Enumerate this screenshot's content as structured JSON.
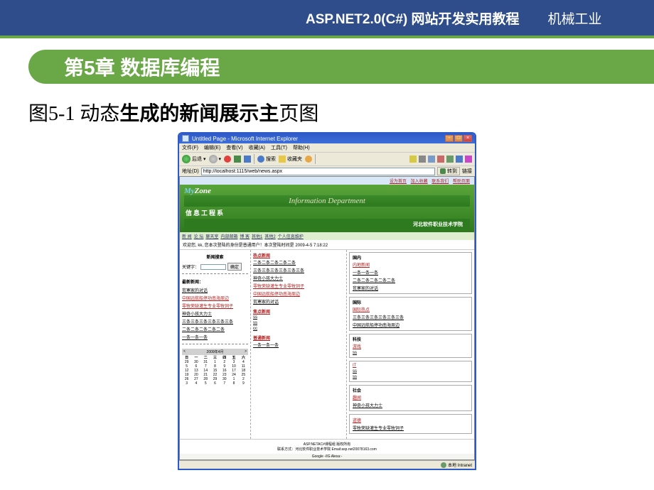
{
  "top": {
    "title": "ASP.NET2.0(C#) 网站开发实用教程",
    "publisher": "机械工业"
  },
  "chapter": "第5章 数据库编程",
  "figure_caption": {
    "prefix": "图5-1 动态",
    "bold1": "生成的新闻",
    "mid": "展示主",
    "suffix": "页图"
  },
  "ie": {
    "title": "Untitled Page - Microsoft Internet Explorer",
    "menus": [
      "文件(F)",
      "编辑(E)",
      "查看(V)",
      "收藏(A)",
      "工具(T)",
      "帮助(H)"
    ],
    "back": "后退",
    "search": "搜索",
    "fav": "收藏夹",
    "addr_label": "地址(D)",
    "url": "http://localhost:1115/web/news.aspx",
    "go": "转到",
    "links": "链接",
    "status_left": "",
    "status_right": "本地 Intranet"
  },
  "site": {
    "logo_my": "My",
    "logo_zone": "Zone",
    "toplinks": [
      "设为首页",
      "加入收藏",
      "联系我们",
      "帮助页面"
    ],
    "dept_en": "Information Department",
    "dept_cn": "信息工程系",
    "school": "河北软件职业技术学院",
    "nav": [
      "新 闻",
      "论 坛",
      "聊天室",
      "内部邮箱",
      "博 客",
      "其他1",
      "其他2",
      "个人信息维护"
    ],
    "welcome": "欢迎您, kk, 您本次登陆的身份是普通用户！本次登陆时间是 2009-4-5 7:18:22"
  },
  "left": {
    "search_title": "新闻搜索",
    "keyword_label": "关键字：",
    "btn_ok": "确定",
    "latest_title": "最新新闻：",
    "latest": [
      {
        "t": "贫寒家的对话",
        "red": false
      },
      {
        "t": "中国远航船停功南海周边",
        "red": true
      },
      {
        "t": "零牧荣缺灌生专业零牧饲子",
        "red": true
      },
      {
        "t": "神奇小孩大力士",
        "red": false
      },
      {
        "t": "三条三条三条三条三条三条",
        "red": false
      },
      {
        "t": "二条二条二条二条二条",
        "red": false
      },
      {
        "t": "一条一条一条",
        "red": false
      }
    ],
    "cal_month": "2009年4月",
    "cal_days": [
      "日",
      "一",
      "二",
      "三",
      "四",
      "五",
      "六"
    ],
    "cal_rows": [
      [
        "29",
        "30",
        "31",
        "1",
        "2",
        "3",
        "4"
      ],
      [
        "5",
        "6",
        "7",
        "8",
        "9",
        "10",
        "11"
      ],
      [
        "12",
        "13",
        "14",
        "15",
        "16",
        "17",
        "18"
      ],
      [
        "19",
        "20",
        "21",
        "22",
        "23",
        "24",
        "25"
      ],
      [
        "26",
        "27",
        "28",
        "29",
        "30",
        "1",
        "2"
      ],
      [
        "3",
        "4",
        "5",
        "6",
        "7",
        "8",
        "9"
      ]
    ]
  },
  "mid": {
    "hot_title": "热点新闻",
    "hot": [
      {
        "t": "二条二条二条二条二条",
        "red": false
      },
      {
        "t": "三条三条三条三条三条三条",
        "red": false
      },
      {
        "t": "神奇小孩大力士",
        "red": false
      },
      {
        "t": "零牧荣缺灌生专业零牧饲子",
        "red": true
      },
      {
        "t": "中国远航船停功南海周边",
        "red": true
      },
      {
        "t": "贫寒家的对话",
        "red": false
      }
    ],
    "focus_title": "焦点新闻",
    "focus": [
      "ss",
      "ss",
      "cc"
    ],
    "normal_title": "普通新闻",
    "normal": [
      "一条一条一条"
    ]
  },
  "right": {
    "cats": [
      {
        "cat": "国内",
        "sub": "内地新闻",
        "items": [
          "一条一条一条",
          "二条二条二条二条二条",
          "贫寒家的对话"
        ]
      },
      {
        "cat": "国际",
        "sub": "国际热点",
        "items": [
          "三条三条三条三条三条三条",
          "中国远航船停功南海周边"
        ]
      },
      {
        "cat": "科技",
        "sub": "游戏",
        "items": [
          "ss"
        ]
      },
      {
        "cat": "",
        "sub": "IT",
        "items": [
          "ss",
          "ss"
        ]
      },
      {
        "cat": "社会",
        "sub": "趣闻",
        "items": [
          "神奇小孩大力士"
        ]
      },
      {
        "cat": "",
        "sub": "道德",
        "items": [
          "零牧荣缺灌生专业零牧饲子"
        ]
      }
    ]
  },
  "footer": {
    "line1": "ASP.NETAC#课程组 版权所有",
    "line2": "联系方式：河北软件职业技术学院 Email:asp.net20078163.com",
    "bar_left": "Google -/IG  Alexa:-",
    "bar_right": ""
  }
}
